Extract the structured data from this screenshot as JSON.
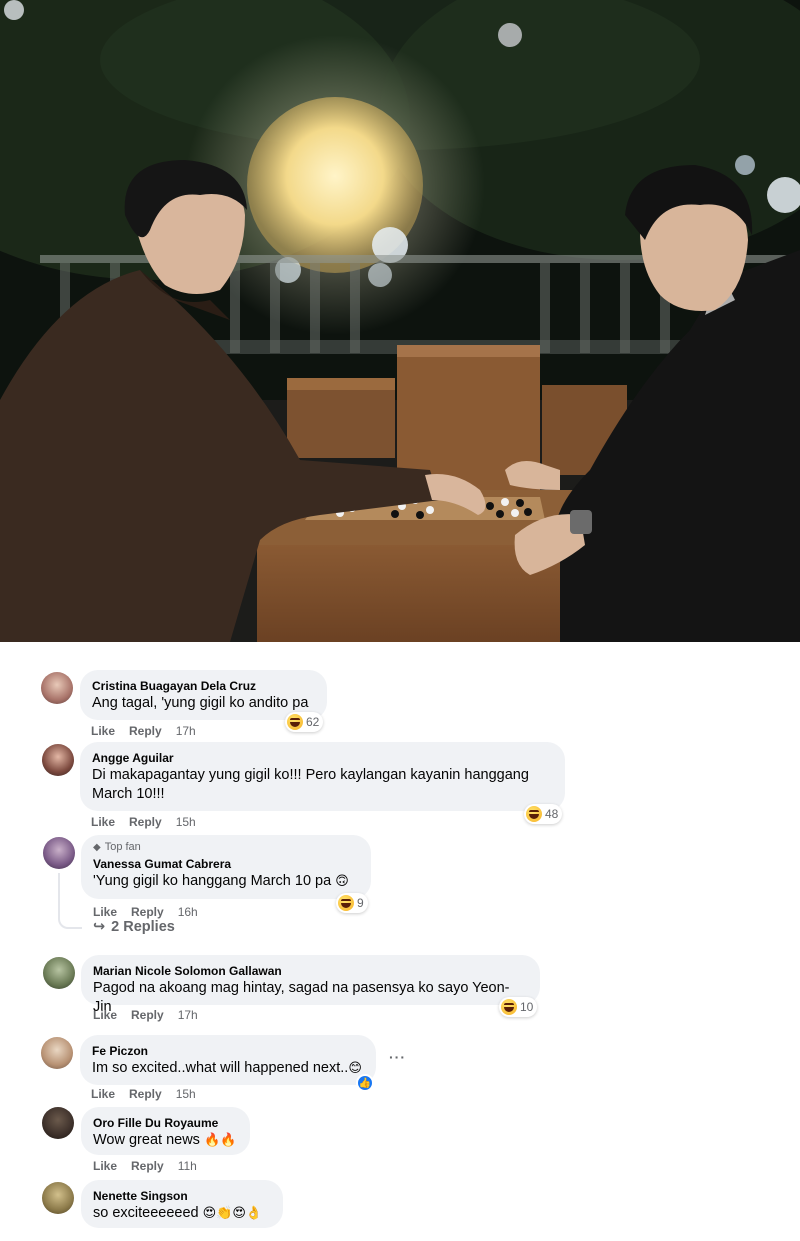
{
  "comments": [
    {
      "name": "Cristina Buagayan Dela Cruz",
      "text": "Ang tagal, 'yung gigil ko andito pa",
      "like": "Like",
      "reply": "Reply",
      "time": "17h",
      "reaction_count": "62"
    },
    {
      "name": "Angge Aguilar",
      "text": "Di makapagantay yung gigil ko!!! Pero kaylangan kayanin hanggang March 10!!!",
      "like": "Like",
      "reply": "Reply",
      "time": "15h",
      "reaction_count": "48"
    },
    {
      "name": "Vanessa Gumat Cabrera",
      "badge": "Top fan",
      "text": "'Yung gigil ko hanggang March 10 pa",
      "emoji": "🙃",
      "like": "Like",
      "reply": "Reply",
      "time": "16h",
      "reaction_count": "9",
      "replies": "2 Replies"
    },
    {
      "name": "Marian Nicole Solomon Gallawan",
      "text": "Pagod na akoang mag hintay, sagad na pasensya ko sayo Yeon- Jin",
      "like": "Like",
      "reply": "Reply",
      "time": "17h",
      "reaction_count": "10"
    },
    {
      "name": "Fe Piczon",
      "text": "Im so excited..what will happened next..",
      "emoji": "😊",
      "like": "Like",
      "reply": "Reply",
      "time": "15h",
      "more": "···"
    },
    {
      "name": "Oro Fille Du Royaume",
      "text": "Wow great news",
      "emoji": "🔥🔥",
      "like": "Like",
      "reply": "Reply",
      "time": "11h"
    },
    {
      "name": "Nenette Singson",
      "text": "so exciteeeeeed",
      "emoji": "😍👏😍👌"
    }
  ],
  "icons": {
    "reaction": "haha-emoji-icon",
    "like": "like-thumb-icon",
    "top_fan": "diamond-icon",
    "reply_arrow": "reply-arrow-icon"
  },
  "colors": {
    "bubble": "#f0f2f5",
    "secondary_text": "#65676b",
    "like_blue": "#1877f2"
  }
}
